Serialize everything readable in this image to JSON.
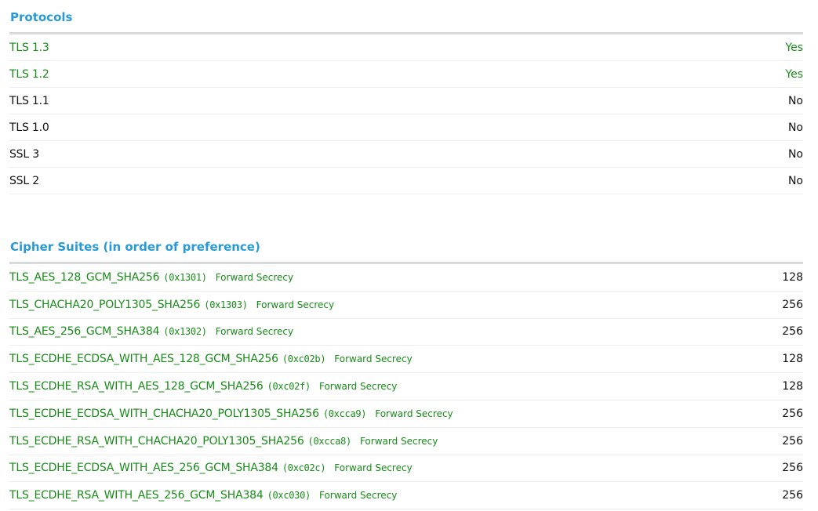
{
  "colors": {
    "accent": "#2a9ad6",
    "good": "#178c17",
    "neutral": "#111111",
    "rule": "#d9dadb"
  },
  "protocols": {
    "title": "Protocols",
    "rows": [
      {
        "name": "TLS 1.3",
        "value": "Yes",
        "status": "good"
      },
      {
        "name": "TLS 1.2",
        "value": "Yes",
        "status": "good"
      },
      {
        "name": "TLS 1.1",
        "value": "No",
        "status": "neutral"
      },
      {
        "name": "TLS 1.0",
        "value": "No",
        "status": "neutral"
      },
      {
        "name": "SSL 3",
        "value": "No",
        "status": "neutral"
      },
      {
        "name": "SSL 2",
        "value": "No",
        "status": "neutral"
      }
    ]
  },
  "ciphers": {
    "title": "Cipher Suites (in order of preference)",
    "rows": [
      {
        "name": "TLS_AES_128_GCM_SHA256",
        "hex": "(0x1301)",
        "note": "Forward Secrecy",
        "bits": "128"
      },
      {
        "name": "TLS_CHACHA20_POLY1305_SHA256",
        "hex": "(0x1303)",
        "note": "Forward Secrecy",
        "bits": "256"
      },
      {
        "name": "TLS_AES_256_GCM_SHA384",
        "hex": "(0x1302)",
        "note": "Forward Secrecy",
        "bits": "256"
      },
      {
        "name": "TLS_ECDHE_ECDSA_WITH_AES_128_GCM_SHA256",
        "hex": "(0xc02b)",
        "note": "Forward Secrecy",
        "bits": "128"
      },
      {
        "name": "TLS_ECDHE_RSA_WITH_AES_128_GCM_SHA256",
        "hex": "(0xc02f)",
        "note": "Forward Secrecy",
        "bits": "128"
      },
      {
        "name": "TLS_ECDHE_ECDSA_WITH_CHACHA20_POLY1305_SHA256",
        "hex": "(0xcca9)",
        "note": "Forward Secrecy",
        "bits": "256"
      },
      {
        "name": "TLS_ECDHE_RSA_WITH_CHACHA20_POLY1305_SHA256",
        "hex": "(0xcca8)",
        "note": "Forward Secrecy",
        "bits": "256"
      },
      {
        "name": "TLS_ECDHE_ECDSA_WITH_AES_256_GCM_SHA384",
        "hex": "(0xc02c)",
        "note": "Forward Secrecy",
        "bits": "256"
      },
      {
        "name": "TLS_ECDHE_RSA_WITH_AES_256_GCM_SHA384",
        "hex": "(0xc030)",
        "note": "Forward Secrecy",
        "bits": "256"
      }
    ]
  }
}
